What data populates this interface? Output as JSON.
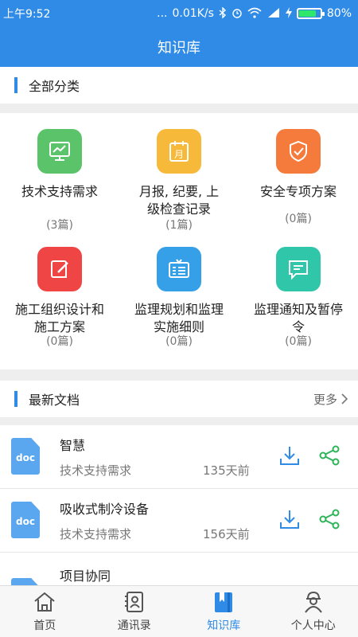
{
  "status_bar": {
    "time": "上午9:52",
    "dots": "...",
    "speed": "0.01K/s",
    "battery": "80%",
    "battery_level": 0.8
  },
  "header": {
    "title": "知识库"
  },
  "categories_section": {
    "title": "全部分类"
  },
  "categories": [
    {
      "name": "技术支持需求",
      "count": "(3篇)",
      "icon": "chart-monitor-icon",
      "color": "#5bc36a"
    },
    {
      "name": "月报, 纪要, 上级检查记录",
      "count": "(1篇)",
      "icon": "calendar-month-icon",
      "color": "#f6b93a"
    },
    {
      "name": "安全专项方案",
      "count": "(0篇)",
      "icon": "shield-check-icon",
      "color": "#f47b3b"
    },
    {
      "name": "施工组织设计和施工方案",
      "count": "(0篇)",
      "icon": "edit-note-icon",
      "color": "#f04545"
    },
    {
      "name": "监理规划和监理实施细则",
      "count": "(0篇)",
      "icon": "id-card-icon",
      "color": "#35a0e8"
    },
    {
      "name": "监理通知及暂停令",
      "count": "(0篇)",
      "icon": "message-icon",
      "color": "#2fc6a9"
    }
  ],
  "latest_section": {
    "title": "最新文档",
    "more": "更多"
  },
  "documents": [
    {
      "title": "智慧",
      "category": "技术支持需求",
      "time": "135天前",
      "type": "doc"
    },
    {
      "title": "吸收式制冷设备",
      "category": "技术支持需求",
      "time": "156天前",
      "type": "doc"
    },
    {
      "title": "项目协同",
      "category": "",
      "time": "",
      "type": "doc"
    }
  ],
  "tabs": [
    {
      "label": "首页",
      "icon": "home-icon",
      "active": false
    },
    {
      "label": "通讯录",
      "icon": "contacts-icon",
      "active": false
    },
    {
      "label": "知识库",
      "icon": "knowledge-icon",
      "active": true
    },
    {
      "label": "个人中心",
      "icon": "user-center-icon",
      "active": false
    }
  ],
  "colors": {
    "primary": "#2f8be6",
    "section_gap": "#eeeeee"
  }
}
